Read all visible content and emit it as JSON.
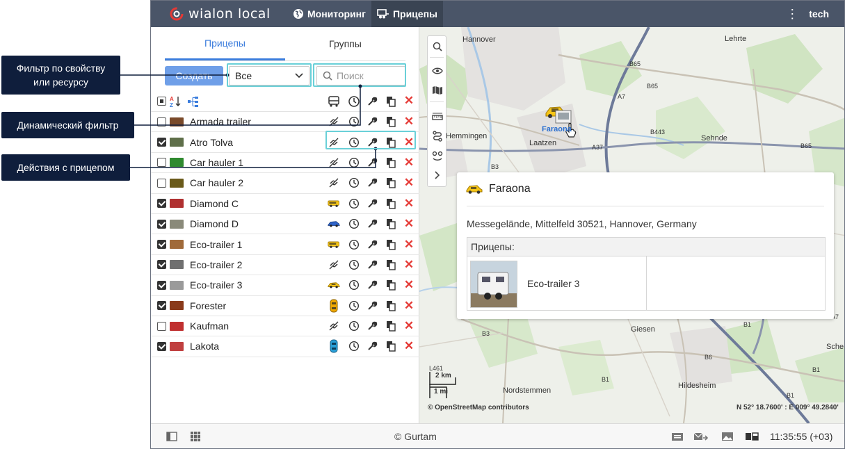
{
  "topbar": {
    "logo_text": "wialon local",
    "nav": [
      {
        "label": "Мониторинг",
        "icon": "globe-icon",
        "active": false
      },
      {
        "label": "Прицепы",
        "icon": "trailer-icon",
        "active": true
      }
    ],
    "user": "tech"
  },
  "panel": {
    "tabs": [
      {
        "label": "Прицепы",
        "active": true
      },
      {
        "label": "Группы",
        "active": false
      }
    ],
    "create_label": "Создать",
    "filter_value": "Все",
    "search_placeholder": "Поиск",
    "rows": [
      {
        "name": "Armada trailer",
        "checked": false,
        "unit": "unlink",
        "thumb": "#7a4a2a"
      },
      {
        "name": "Atro Tolva",
        "checked": true,
        "unit": "unlink",
        "thumb": "#5f6f4a"
      },
      {
        "name": "Car hauler 1",
        "checked": false,
        "unit": "unlink",
        "thumb": "#2f8a2f"
      },
      {
        "name": "Car hauler 2",
        "checked": false,
        "unit": "unlink",
        "thumb": "#6a5a1a"
      },
      {
        "name": "Diamond C",
        "checked": true,
        "unit": "bus-yellow",
        "thumb": "#b03030"
      },
      {
        "name": "Diamond D",
        "checked": true,
        "unit": "car-blue",
        "thumb": "#8a8a7a"
      },
      {
        "name": "Eco-trailer 1",
        "checked": true,
        "unit": "bus-yellow",
        "thumb": "#a06a3a"
      },
      {
        "name": "Eco-trailer 2",
        "checked": true,
        "unit": "unlink",
        "thumb": "#707070"
      },
      {
        "name": "Eco-trailer 3",
        "checked": true,
        "unit": "car-yellow",
        "thumb": "#9a9a9a"
      },
      {
        "name": "Forester",
        "checked": true,
        "unit": "car-top-yellow",
        "thumb": "#8a3a1a"
      },
      {
        "name": "Kaufman",
        "checked": false,
        "unit": "unlink",
        "thumb": "#c03030"
      },
      {
        "name": "Lakota",
        "checked": true,
        "unit": "car-top-blue",
        "thumb": "#c04040"
      }
    ]
  },
  "map": {
    "labels": [
      "Hannover",
      "Lehrte",
      "Hemmingen",
      "Laatzen",
      "Sehnde",
      "Giesen",
      "Nordstemmen",
      "Hildesheim",
      "Sche"
    ],
    "road_labels": [
      "B65",
      "B65",
      "A7",
      "B443",
      "A37",
      "B65",
      "B3",
      "B1",
      "B1",
      "A7",
      "B3",
      "B1",
      "L461",
      "B1",
      "B6"
    ],
    "unit_label": "Faraona",
    "popup": {
      "title": "Faraona",
      "address": "Messegelände, Mittelfeld 30521, Hannover, Germany",
      "table_header": "Прицепы:",
      "trailer": "Eco-trailer 3"
    },
    "scale_km": "2 km",
    "scale_mi": "1 mi",
    "attribution": "© OpenStreetMap contributors",
    "coords": "N 52° 18.7600' : E 009° 49.2840'"
  },
  "bottombar": {
    "copyright": "© Gurtam",
    "time": "11:35:55 (+03)"
  },
  "callouts": {
    "filter": "Фильтр по свойству или ресурсу",
    "dynamic": "Динамический фильтр",
    "actions": "Действия с прицепом"
  },
  "colors": {
    "topbar": "#4a5568",
    "accent": "#3b7ddd",
    "callout": "#0f1e3c",
    "highlight": "#6ad0d8",
    "delete": "#e53935"
  }
}
